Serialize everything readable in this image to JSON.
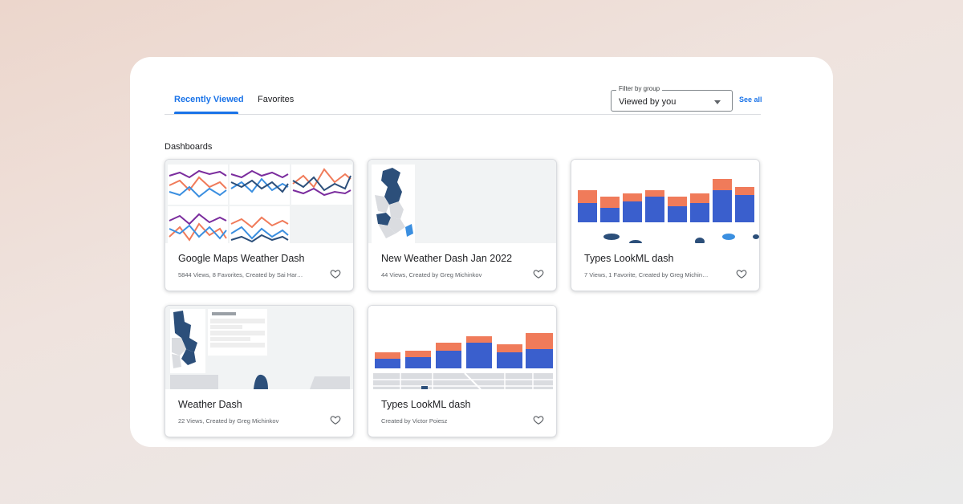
{
  "tabs": [
    {
      "label": "Recently Viewed",
      "active": true
    },
    {
      "label": "Favorites",
      "active": false
    }
  ],
  "filter": {
    "label": "Filter by group",
    "value": "Viewed by you"
  },
  "see_all": "See all",
  "section_title": "Dashboards",
  "cards": [
    {
      "title": "Google Maps Weather Dash",
      "meta": "5844 Views, 8 Favorites, Created by Sai Har…"
    },
    {
      "title": "New Weather Dash Jan 2022",
      "meta": "44 Views, Created by Greg Michinkov"
    },
    {
      "title": "Types LookML dash",
      "meta": "7 Views, 1 Favorite, Created by Greg Michin…"
    },
    {
      "title": "Weather Dash",
      "meta": "22 Views, Created by Greg Michinkov"
    },
    {
      "title": "Types LookML dash",
      "meta": "Created by Victor Poiesz"
    }
  ],
  "colors": {
    "accent": "#1a73e8",
    "bar_blue": "#3a5fcd",
    "bar_orange": "#f07b5a",
    "line_purple": "#7b2d9e",
    "line_blue": "#3b8fe0",
    "map_navy": "#2c4f7a"
  }
}
